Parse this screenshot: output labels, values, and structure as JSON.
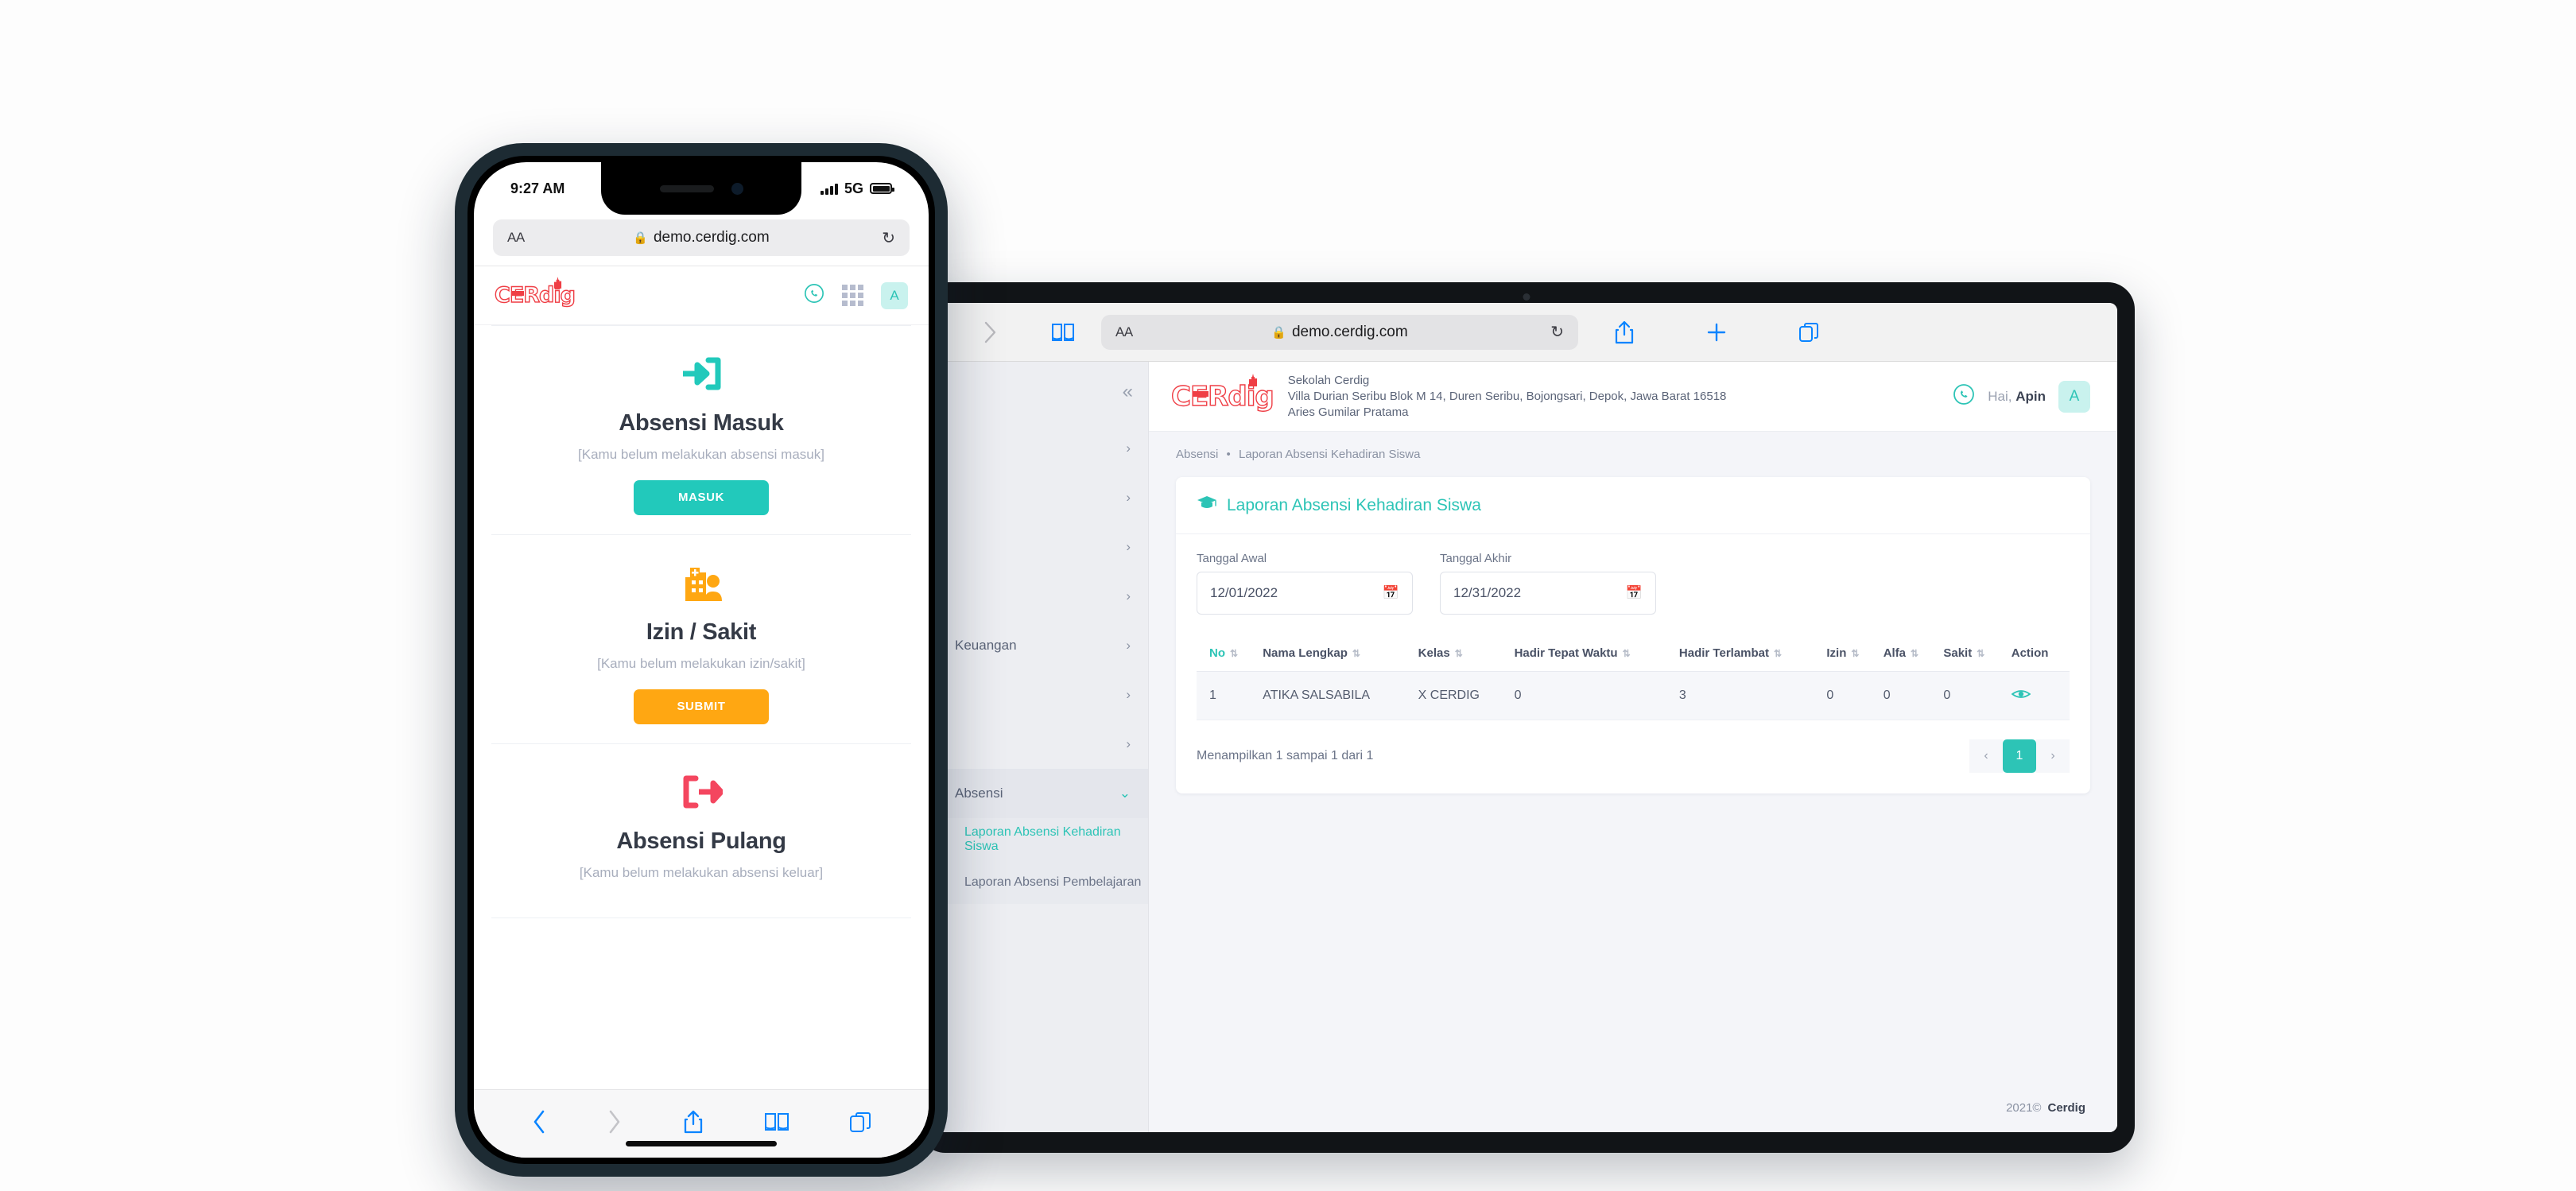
{
  "phone": {
    "status_bar": {
      "time": "9:27 AM",
      "network": "5G"
    },
    "browser": {
      "aa_label": "AA",
      "url": "demo.cerdig.com",
      "lock_icon": "lock-icon",
      "reload_icon": "reload-icon",
      "bottom_nav": [
        "back-icon",
        "forward-icon",
        "share-icon",
        "bookmarks-icon",
        "tabs-icon"
      ]
    },
    "app_header": {
      "logo": "CERdig",
      "whatsapp_icon": "whatsapp-icon",
      "apps_grid_icon": "grid-icon",
      "avatar_initial": "A"
    },
    "sections": [
      {
        "icon": "login-arrow-icon",
        "icon_color": "#22c9bb",
        "title": "Absensi Masuk",
        "subtitle": "[Kamu belum melakukan absensi masuk]",
        "button": "MASUK",
        "button_color": "#22c9bb"
      },
      {
        "icon": "hospital-person-icon",
        "icon_color": "#ffa712",
        "title": "Izin / Sakit",
        "subtitle": "[Kamu belum melakukan izin/sakit]",
        "button": "SUBMIT",
        "button_color": "#ffa712"
      },
      {
        "icon": "logout-arrow-icon",
        "icon_color": "#f4465f",
        "title": "Absensi Pulang",
        "subtitle": "[Kamu belum melakukan absensi keluar]",
        "button": "",
        "button_color": "#f4465f"
      }
    ]
  },
  "tablet": {
    "browser": {
      "forward_icon": "chevron-right-icon",
      "bookmarks_icon": "book-icon",
      "aa_label": "AA",
      "url": "demo.cerdig.com",
      "lock_icon": "lock-icon",
      "reload_icon": "reload-icon",
      "share_icon": "share-icon",
      "new_tab_icon": "plus-icon",
      "tabs_icon": "tabs-icon"
    },
    "sidebar": {
      "collapse_icon": "chevrons-left-icon",
      "items": [
        {
          "label": "",
          "chevron": "›"
        },
        {
          "label": "",
          "chevron": "›"
        },
        {
          "label": "",
          "chevron": "›"
        },
        {
          "label": "",
          "chevron": "›"
        },
        {
          "label": "Keuangan",
          "chevron": "›"
        },
        {
          "label": "",
          "chevron": "›"
        },
        {
          "label": "",
          "chevron": "›"
        },
        {
          "label": "Absensi",
          "chevron": "⌄",
          "open": true
        }
      ],
      "sub_items": [
        {
          "label": "Laporan Absensi Kehadiran Siswa",
          "active": true
        },
        {
          "label": "Laporan Absensi Pembelajaran",
          "active": false
        }
      ]
    },
    "header": {
      "logo": "CERdig",
      "school_name": "Sekolah Cerdig",
      "school_address": "Villa Durian Seribu Blok M 14, Duren Seribu, Bojongsari, Depok, Jawa Barat 16518",
      "school_person": "Aries Gumilar Pratama",
      "whatsapp_icon": "whatsapp-icon",
      "greeting_prefix": "Hai,",
      "user_name": "Apin",
      "avatar_initial": "A"
    },
    "breadcrumb": {
      "parent": "Absensi",
      "separator": "•",
      "current": "Laporan Absensi Kehadiran Siswa"
    },
    "card": {
      "icon": "graduation-cap-icon",
      "title": "Laporan Absensi Kehadiran Siswa",
      "filters": [
        {
          "label": "Tanggal Awal",
          "value": "12/01/2022",
          "icon": "calendar-icon"
        },
        {
          "label": "Tanggal Akhir",
          "value": "12/31/2022",
          "icon": "calendar-icon"
        }
      ],
      "table": {
        "columns": [
          {
            "label": "No",
            "sortable": true
          },
          {
            "label": "Nama Lengkap",
            "sortable": true
          },
          {
            "label": "Kelas",
            "sortable": true
          },
          {
            "label": "Hadir Tepat Waktu",
            "sortable": true
          },
          {
            "label": "Hadir Terlambat",
            "sortable": true
          },
          {
            "label": "Izin",
            "sortable": true
          },
          {
            "label": "Alfa",
            "sortable": true
          },
          {
            "label": "Sakit",
            "sortable": true
          },
          {
            "label": "Action",
            "sortable": false
          }
        ],
        "rows": [
          {
            "no": "1",
            "nama": "ATIKA SALSABILA",
            "kelas": "X CERDIG",
            "hadir_tepat_waktu": "0",
            "hadir_terlambat": "3",
            "izin": "0",
            "alfa": "0",
            "sakit": "0",
            "action_icon": "eye-icon"
          }
        ]
      },
      "showing_text": "Menampilkan 1 sampai 1 dari 1",
      "pagination": {
        "prev": "‹",
        "pages": [
          "1"
        ],
        "next": "›",
        "current": "1"
      }
    },
    "footer": {
      "year": "2021©",
      "brand": "Cerdig"
    }
  },
  "colors": {
    "teal": "#2dc4b6",
    "teal_bright": "#22c9bb",
    "orange": "#ffa712",
    "red": "#f4465f",
    "logo_red": "#ef3e45",
    "ios_blue": "#0a84ff"
  }
}
